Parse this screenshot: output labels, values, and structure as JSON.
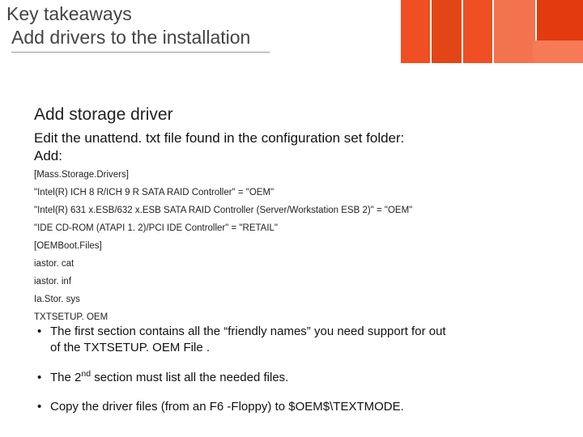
{
  "title": {
    "line1": "Key takeaways",
    "line2": "Add drivers to the installation"
  },
  "subtitle": "Add storage driver",
  "desc": {
    "line1": "Edit the unattend. txt file found in the configuration set folder:",
    "line2": " Add:"
  },
  "code": [
    "[Mass.Storage.Drivers]",
    "\"Intel(R) ICH 8 R/ICH 9 R SATA RAID Controller\" = \"OEM\"",
    "\"Intel(R) 631 x.ESB/632 x.ESB SATA RAID Controller (Server/Workstation ESB 2)\" = \"OEM\"",
    "\"IDE CD-ROM (ATAPI 1. 2)/PCI IDE Controller\" = \"RETAIL\"",
    "[OEMBoot.Files]",
    "iastor. cat",
    "iastor. inf",
    "Ia.Stor. sys",
    "TXTSETUP. OEM"
  ],
  "bullets": {
    "b1a": "The first section contains all the “friendly names” you need support for out",
    "b1b": "of the TXTSETUP. OEM File .",
    "b2a": "The 2",
    "b2sup": "nd",
    "b2b": " section must list all the needed files.",
    "b3": "Copy the driver files (from an F6 -Floppy) to $OEM$\\TEXTMODE."
  }
}
